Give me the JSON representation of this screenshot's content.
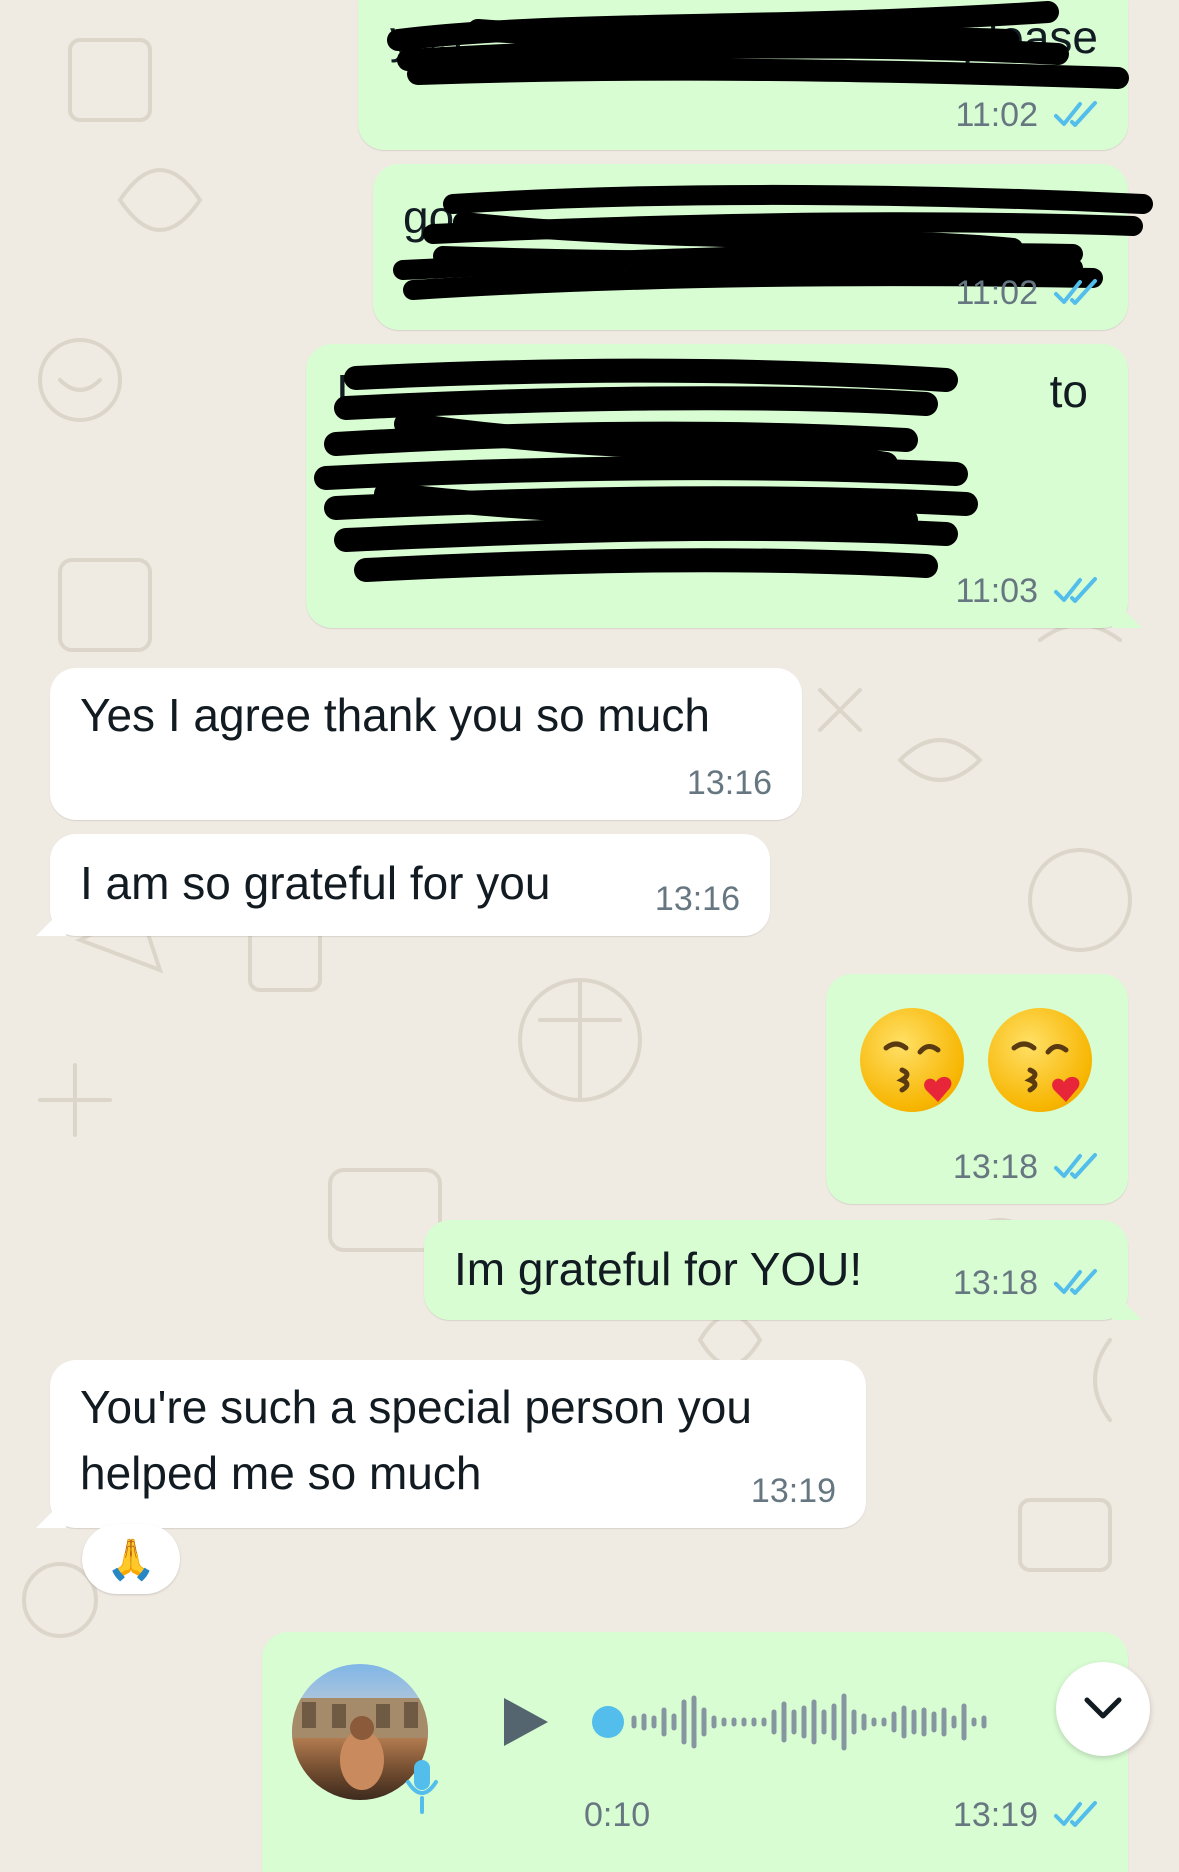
{
  "messages": [
    {
      "id": "m1",
      "direction": "outgoing",
      "text_visible": "yes",
      "text_visible_end": "please",
      "time": "11:02",
      "status": "read",
      "redacted": true
    },
    {
      "id": "m2",
      "direction": "outgoing",
      "text_visible": "go",
      "time": "11:02",
      "status": "read",
      "redacted": true
    },
    {
      "id": "m3",
      "direction": "outgoing",
      "text_visible": "I",
      "text_visible_end": "to",
      "time": "11:03",
      "status": "read",
      "redacted": true
    },
    {
      "id": "m4",
      "direction": "incoming",
      "text": "Yes I agree thank you so much",
      "time": "13:16"
    },
    {
      "id": "m5",
      "direction": "incoming",
      "text": "I am so grateful for you",
      "time": "13:16"
    },
    {
      "id": "m6",
      "direction": "outgoing",
      "emoji": "face-blowing-a-kiss x2",
      "time": "13:18",
      "status": "read"
    },
    {
      "id": "m7",
      "direction": "outgoing",
      "text": "Im grateful for YOU!",
      "time": "13:18",
      "status": "read"
    },
    {
      "id": "m8",
      "direction": "incoming",
      "text_line1": "You're such a special person you",
      "text_line2": "helped me so much",
      "time": "13:19",
      "reaction": "🙏"
    },
    {
      "id": "m9",
      "direction": "outgoing",
      "type": "voice",
      "duration": "0:10",
      "time": "13:19",
      "status": "read",
      "playback_progress": 0
    }
  ],
  "colors": {
    "wallpaper": "#efeae2",
    "outgoing_bubble": "#d9fdd3",
    "incoming_bubble": "#ffffff",
    "read_ticks": "#53bdeb",
    "time_text": "#667781",
    "voice_dot": "#53bdeb"
  },
  "icons": {
    "play": "play-icon",
    "mic": "microphone-icon",
    "scroll_down": "chevron-down-icon",
    "ticks": "double-check-icon"
  }
}
